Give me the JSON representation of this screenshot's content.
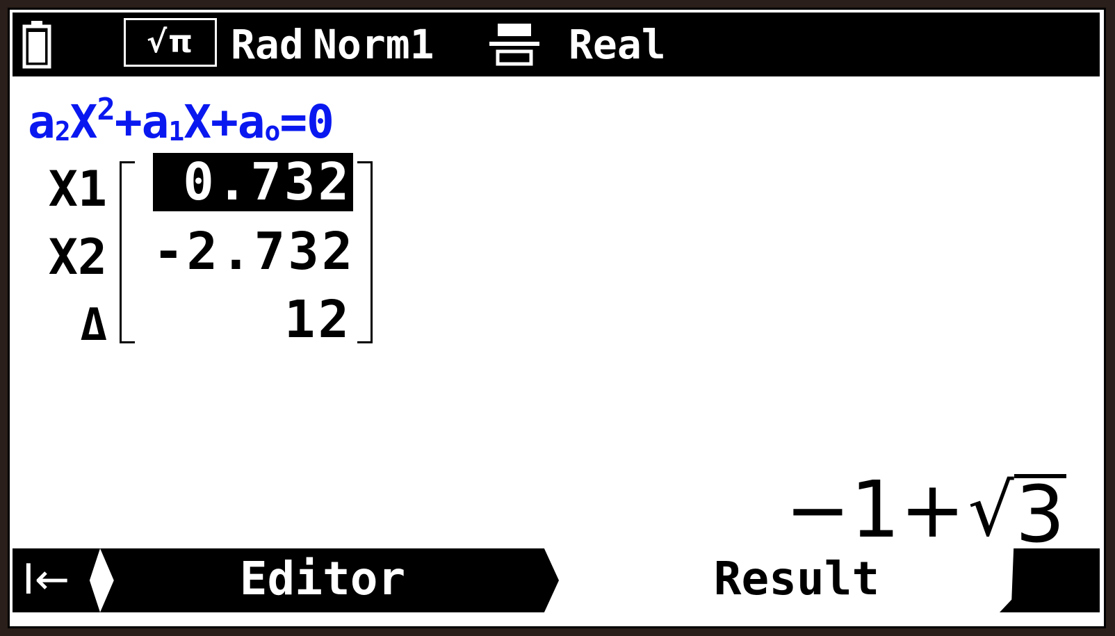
{
  "status_bar": {
    "math_io": "√π",
    "angle_mode": "Rad",
    "display_mode": "Norm1",
    "complex_mode": "Real",
    "icons": [
      "battery-icon",
      "fraction-format-icon"
    ]
  },
  "equation": {
    "a2": "a",
    "a2_sub": "2",
    "x": "X",
    "x_sup": "2",
    "plus1": "+",
    "a1": "a",
    "a1_sub": "1",
    "x2": "X",
    "plus2": "+",
    "a0": "a",
    "a0_sub": "o",
    "equals": "=0"
  },
  "results": {
    "rows": [
      {
        "label": "X1",
        "value": "0.732"
      },
      {
        "label": "X2",
        "value": "-2.732"
      },
      {
        "label": "Δ",
        "value": "12"
      }
    ],
    "selected_row": "X1"
  },
  "exact_value": {
    "prefix": "−1+",
    "sqrt": "√",
    "radicand": "3"
  },
  "tabs": {
    "back_icon": "I←",
    "editor": "Editor",
    "result": "Result"
  },
  "colors": {
    "equation": "#0a18f0",
    "bar": "#000000",
    "screen": "#ffffff"
  }
}
